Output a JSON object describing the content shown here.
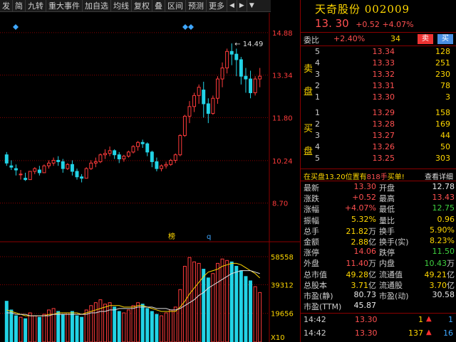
{
  "toolbar": {
    "items": [
      "发",
      "简",
      "九转",
      "重大事件",
      "加自选",
      "均线",
      "复权",
      "叠",
      "区间",
      "预测",
      "更多"
    ]
  },
  "chart": {
    "price_axis": [
      "14.88",
      "13.34",
      "11.80",
      "10.24",
      "8.70"
    ],
    "volume_axis": [
      "58558",
      "39312",
      "19656"
    ],
    "volume_unit": "X10",
    "max_label": "← 14.49",
    "indicator_tags": [
      "榜",
      "q"
    ]
  },
  "chart_data": {
    "type": "candlestick",
    "ylim": [
      7.4,
      15.6
    ],
    "candles": [
      [
        10.45,
        10.55,
        10.15,
        10.05
      ],
      [
        10.05,
        10.25,
        10.0,
        9.9
      ],
      [
        9.95,
        10.1,
        9.9,
        9.7
      ],
      [
        9.75,
        9.9,
        9.75,
        9.55
      ],
      [
        9.6,
        9.8,
        9.55,
        9.5
      ],
      [
        9.55,
        9.85,
        9.85,
        9.55
      ],
      [
        9.85,
        10.0,
        9.95,
        9.75
      ],
      [
        9.9,
        10.05,
        9.8,
        9.7
      ],
      [
        9.8,
        10.1,
        10.05,
        9.8
      ],
      [
        10.05,
        10.25,
        10.15,
        9.95
      ],
      [
        10.15,
        10.35,
        10.25,
        10.05
      ],
      [
        10.25,
        10.4,
        10.2,
        10.05
      ],
      [
        10.2,
        10.3,
        9.95,
        9.8
      ],
      [
        9.95,
        10.15,
        10.1,
        9.9
      ],
      [
        10.1,
        10.25,
        9.85,
        9.7
      ],
      [
        9.85,
        9.95,
        9.65,
        9.55
      ],
      [
        9.65,
        9.75,
        9.6,
        9.45
      ],
      [
        9.6,
        10.0,
        9.95,
        9.6
      ],
      [
        9.95,
        10.25,
        10.15,
        9.9
      ],
      [
        10.15,
        10.35,
        10.2,
        10.0
      ],
      [
        10.2,
        10.5,
        10.45,
        10.15
      ],
      [
        10.45,
        10.65,
        10.5,
        10.3
      ],
      [
        10.5,
        10.75,
        10.6,
        10.4
      ],
      [
        10.6,
        10.65,
        10.45,
        10.3
      ],
      [
        10.45,
        10.55,
        10.3,
        10.15
      ],
      [
        10.3,
        10.45,
        10.4,
        10.2
      ],
      [
        10.4,
        10.6,
        10.55,
        10.35
      ],
      [
        10.55,
        10.8,
        10.75,
        10.5
      ],
      [
        10.75,
        10.95,
        10.9,
        10.6
      ],
      [
        10.9,
        11.0,
        10.85,
        10.7
      ],
      [
        10.85,
        10.9,
        10.55,
        10.4
      ],
      [
        10.55,
        10.6,
        10.2,
        10.0
      ],
      [
        10.2,
        10.35,
        9.95,
        9.85
      ],
      [
        9.95,
        10.1,
        10.05,
        9.85
      ],
      [
        10.05,
        10.2,
        10.1,
        9.95
      ],
      [
        10.1,
        10.3,
        10.25,
        10.05
      ],
      [
        10.25,
        10.5,
        10.45,
        10.15
      ],
      [
        10.45,
        11.2,
        11.15,
        10.4
      ],
      [
        11.15,
        11.9,
        11.85,
        11.1
      ],
      [
        11.85,
        12.4,
        12.2,
        11.6
      ],
      [
        12.2,
        12.7,
        12.6,
        12.0
      ],
      [
        12.6,
        13.0,
        12.9,
        12.3
      ],
      [
        12.8,
        13.1,
        12.3,
        11.8
      ],
      [
        12.3,
        12.5,
        11.95,
        11.6
      ],
      [
        11.95,
        12.6,
        12.5,
        11.9
      ],
      [
        12.5,
        13.3,
        13.2,
        12.3
      ],
      [
        13.2,
        13.8,
        13.6,
        12.9
      ],
      [
        13.6,
        14.3,
        14.2,
        13.4
      ],
      [
        14.2,
        14.49,
        14.1,
        13.7
      ],
      [
        14.1,
        14.3,
        13.9,
        13.3
      ],
      [
        13.9,
        14.0,
        13.3,
        13.0
      ],
      [
        13.3,
        13.6,
        13.2,
        12.7
      ],
      [
        13.2,
        13.5,
        12.7,
        12.5
      ],
      [
        12.7,
        13.3,
        13.2,
        12.6
      ],
      [
        13.2,
        13.6,
        13.3,
        12.9
      ]
    ],
    "volumes": [
      28,
      22,
      18,
      17,
      16,
      20,
      18,
      17,
      19,
      22,
      23,
      21,
      19,
      20,
      21,
      18,
      17,
      22,
      25,
      27,
      29,
      26,
      27,
      24,
      21,
      20,
      22,
      25,
      27,
      26,
      23,
      21,
      19,
      18,
      20,
      22,
      24,
      36,
      52,
      58,
      55,
      54,
      50,
      44,
      47,
      54,
      57,
      56,
      55,
      52,
      49,
      45,
      42,
      38,
      34
    ],
    "ma_volume_1": [
      22,
      21,
      20,
      19,
      18,
      18,
      18,
      18,
      18,
      19,
      19,
      20,
      20,
      20,
      20,
      20,
      19,
      20,
      21,
      22,
      23,
      24,
      25,
      25,
      25,
      24,
      24,
      24,
      25,
      25,
      24,
      23,
      22,
      21,
      21,
      21,
      21,
      24,
      28,
      33,
      37,
      41,
      45,
      48,
      49,
      50,
      52,
      53,
      54,
      54,
      53,
      51,
      49,
      47,
      44
    ],
    "ma_volume_2": [
      20,
      20,
      19,
      19,
      19,
      18,
      18,
      18,
      18,
      18,
      19,
      19,
      19,
      19,
      19,
      19,
      19,
      19,
      20,
      20,
      21,
      21,
      22,
      22,
      23,
      23,
      23,
      23,
      24,
      24,
      24,
      24,
      23,
      23,
      23,
      22,
      22,
      23,
      25,
      27,
      29,
      32,
      34,
      37,
      39,
      41,
      43,
      45,
      47,
      48,
      49,
      49,
      49,
      48,
      47
    ]
  },
  "stock": {
    "title": "天奇股份 002009",
    "price": "13. 30",
    "change": "+0.52",
    "change_pct": "+4.07%"
  },
  "weibi": {
    "label": "委比",
    "ratio": "+2.40%",
    "diff": "34",
    "buy_btn": "买",
    "sell_btn": "卖"
  },
  "orderbook": {
    "sell_label_1": "卖",
    "sell_label_2": "盘",
    "buy_label_1": "买",
    "buy_label_2": "盘",
    "sells": [
      {
        "level": "5",
        "price": "13.34",
        "vol": "128"
      },
      {
        "level": "4",
        "price": "13.33",
        "vol": "251"
      },
      {
        "level": "3",
        "price": "13.32",
        "vol": "230"
      },
      {
        "level": "2",
        "price": "13.31",
        "vol": "78"
      },
      {
        "level": "1",
        "price": "13.30",
        "vol": "3"
      }
    ],
    "buys": [
      {
        "level": "1",
        "price": "13.29",
        "vol": "158"
      },
      {
        "level": "2",
        "price": "13.28",
        "vol": "169"
      },
      {
        "level": "3",
        "price": "13.27",
        "vol": "44"
      },
      {
        "level": "4",
        "price": "13.26",
        "vol": "50"
      },
      {
        "level": "5",
        "price": "13.25",
        "vol": "303"
      }
    ]
  },
  "trade_note": {
    "prefix": "在买盘13.20位置有",
    "amount": "818手",
    "suffix": "买单!",
    "detail": "查看详细"
  },
  "stats": [
    {
      "l1": "最新",
      "v1": "13.30",
      "c1": "red",
      "u1": "",
      "l2": "开盘",
      "v2": "12.78",
      "c2": "white",
      "u2": ""
    },
    {
      "l1": "涨跌",
      "v1": "+0.52",
      "c1": "red",
      "u1": "",
      "l2": "最高",
      "v2": "13.43",
      "c2": "red",
      "u2": ""
    },
    {
      "l1": "涨幅",
      "v1": "+4.07%",
      "c1": "red",
      "u1": "",
      "l2": "最低",
      "v2": "12.75",
      "c2": "green",
      "u2": ""
    },
    {
      "l1": "振幅",
      "v1": "5.32%",
      "c1": "yellow",
      "u1": "",
      "l2": "量比",
      "v2": "0.96",
      "c2": "yellow",
      "u2": ""
    },
    {
      "l1": "总手",
      "v1": "21.82",
      "c1": "yellow",
      "u1": "万",
      "l2": "换手",
      "v2": "5.90%",
      "c2": "yellow",
      "u2": ""
    },
    {
      "l1": "金额",
      "v1": "2.88",
      "c1": "yellow",
      "u1": "亿",
      "l2": "换手(实)",
      "v2": "8.23%",
      "c2": "yellow",
      "u2": ""
    },
    {
      "l1": "涨停",
      "v1": "14.06",
      "c1": "red",
      "u1": "",
      "l2": "跌停",
      "v2": "11.50",
      "c2": "green",
      "u2": ""
    },
    {
      "l1": "外盘",
      "v1": "11.40",
      "c1": "red",
      "u1": "万",
      "l2": "内盘",
      "v2": "10.43",
      "c2": "green",
      "u2": "万"
    },
    {
      "l1": "总市值",
      "v1": "49.28",
      "c1": "yellow",
      "u1": "亿",
      "l2": "流通值",
      "v2": "49.21",
      "c2": "yellow",
      "u2": "亿"
    },
    {
      "l1": "总股本",
      "v1": "3.71",
      "c1": "yellow",
      "u1": "亿",
      "l2": "流通股",
      "v2": "3.70",
      "c2": "yellow",
      "u2": "亿"
    },
    {
      "l1": "市盈(静)",
      "v1": "80.73",
      "c1": "white",
      "u1": "",
      "l2": "市盈(动)",
      "v2": "30.58",
      "c2": "white",
      "u2": ""
    },
    {
      "l1": "市盈(TTM)",
      "v1": "45.87",
      "c1": "white",
      "u1": "",
      "l2": "",
      "v2": "",
      "c2": "white",
      "u2": ""
    }
  ],
  "ticks": [
    {
      "time": "14:42",
      "price": "13.30",
      "vol": "1",
      "arrow": "▲",
      "num": "1"
    },
    {
      "time": "14:42",
      "price": "13.30",
      "vol": "137",
      "arrow": "▲",
      "num": "16"
    }
  ],
  "colors": {
    "up": "#ff3b3b",
    "down": "#22d3e6",
    "grid": "#8b0000",
    "ma1": "#ffd700",
    "ma2": "#e0e0e0",
    "marker": "#3fa7ff"
  }
}
